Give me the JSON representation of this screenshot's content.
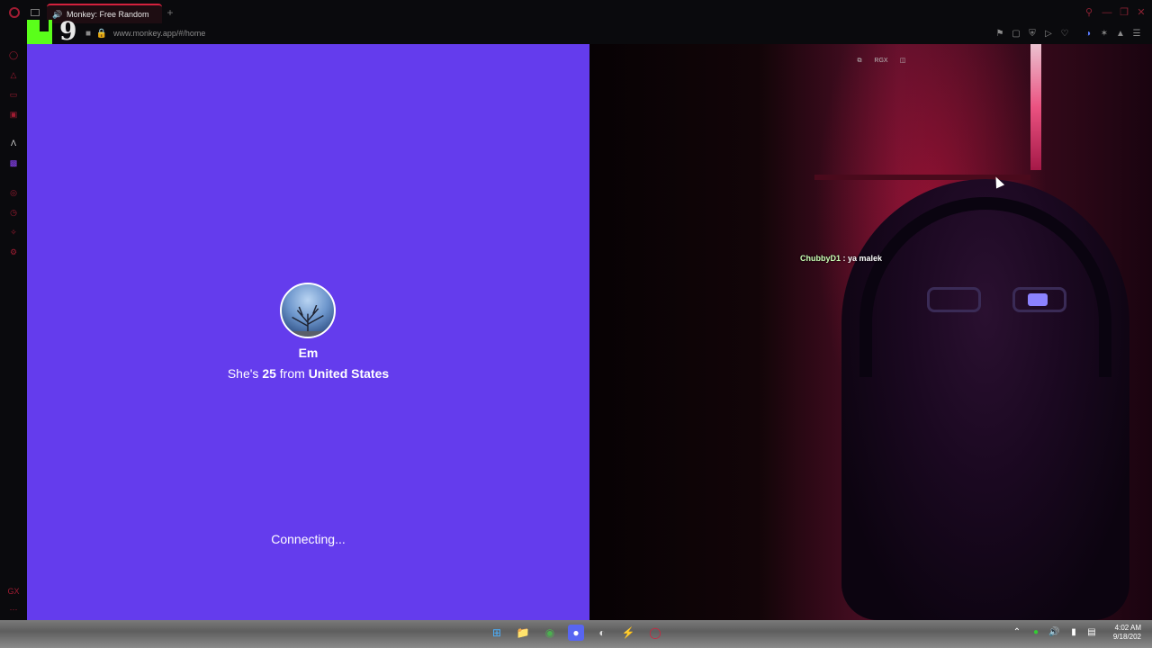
{
  "browser": {
    "tab_title": "Monkey: Free Random",
    "new_tab_symbol": "+",
    "url": "www.monkey.app/#/home",
    "window_controls": [
      "search-icon",
      "minimize-icon",
      "maximize-icon",
      "close-icon"
    ]
  },
  "stream_overlay": {
    "logo_digit": "9",
    "logo_letter_color": "#5aff1a"
  },
  "profile": {
    "name": "Em",
    "bio_prefix": "She's ",
    "age": "25",
    "bio_mid": " from ",
    "country": "United States",
    "status": "Connecting..."
  },
  "webcam": {
    "chat_user": "ChubbyD1",
    "chat_message": " : ya malek",
    "overlay_buttons": [
      "expand-icon",
      "RGX",
      "toggle-icon"
    ]
  },
  "taskbar": {
    "time": "4:02 AM",
    "date": "9/18/202"
  },
  "colors": {
    "accent": "#d4213d",
    "panel_purple": "#643ced",
    "sidebar_bg": "#0a0a0d"
  }
}
